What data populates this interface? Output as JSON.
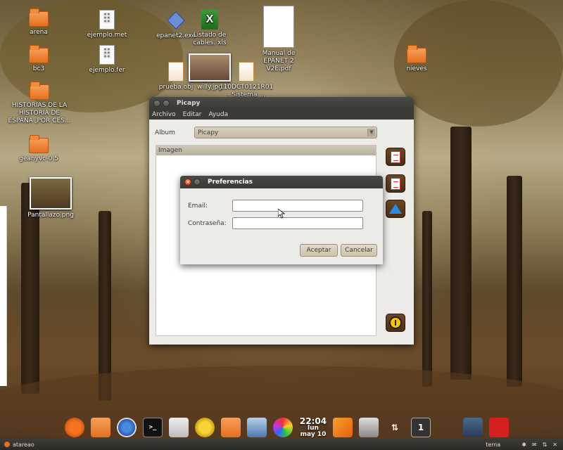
{
  "desktop": {
    "icons": [
      {
        "label": "arena"
      },
      {
        "label": "bc3"
      },
      {
        "label": "HISTORIAS DE LA HISTORIA DE ESPAÑA ,POR CES..."
      },
      {
        "label": "geanyvc-0.5"
      },
      {
        "label": "Pantallazo.png"
      },
      {
        "label": "ejemplo.met"
      },
      {
        "label": "ejemplo.fer"
      },
      {
        "label": "epanet2.exe"
      },
      {
        "label": "Listado de cables. xls"
      },
      {
        "label": "Manual de EPANET 2 V2E.pdf"
      },
      {
        "label": "prueba.obj"
      },
      {
        "label": "willy.jpg"
      },
      {
        "label": "110DCT0121R01 - Sistema ..."
      },
      {
        "label": "nieves"
      }
    ]
  },
  "window": {
    "title": "Picapy",
    "menu": [
      "Archivo",
      "Editar",
      "Ayuda"
    ],
    "album_label": "Album",
    "album_value": "Picapy",
    "image_header": "Imagen"
  },
  "dialog": {
    "title": "Preferencias",
    "email_label": "Email:",
    "email_value": "",
    "password_label": "Contraseña:",
    "password_value": "",
    "accept": "Aceptar",
    "cancel": "Cancelar"
  },
  "dock": {
    "clock_time": "22:04",
    "clock_day": "lun",
    "clock_date": "may 10",
    "workspace": "1"
  },
  "taskbar": {
    "left": "atareao",
    "right": "tema"
  },
  "colors": {
    "accent_orange": "#e46f1f",
    "titlebar": "#3c3b37",
    "power_yellow": "#f2c500",
    "power_red": "#d62020"
  }
}
